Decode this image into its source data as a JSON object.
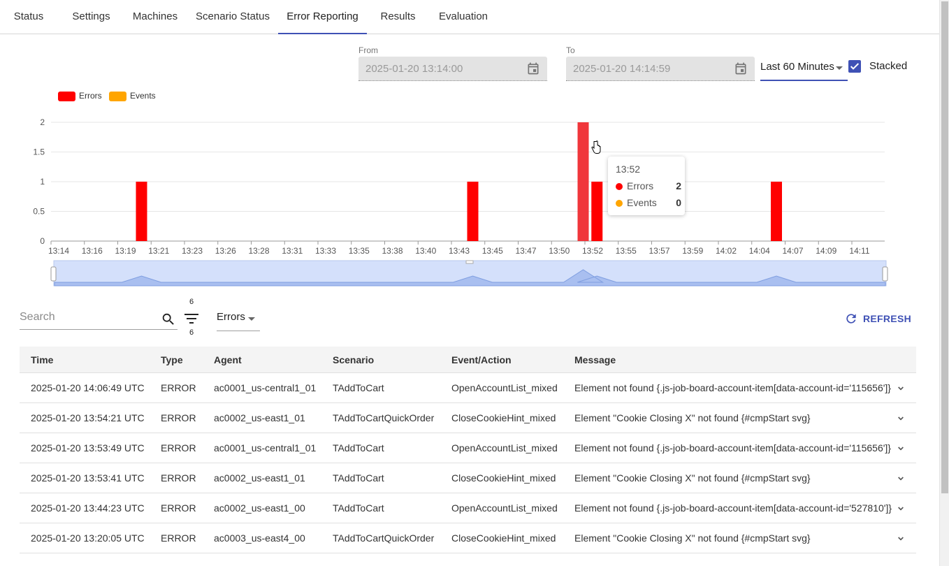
{
  "tabs": [
    {
      "label": "Status"
    },
    {
      "label": "Settings"
    },
    {
      "label": "Machines"
    },
    {
      "label": "Scenario Status"
    },
    {
      "label": "Error Reporting"
    },
    {
      "label": "Results"
    },
    {
      "label": "Evaluation"
    }
  ],
  "active_tab": "Error Reporting",
  "accent_color": "#3f51b5",
  "date_range": {
    "from_label": "From",
    "from_value": "2025-01-20 13:14:00",
    "to_label": "To",
    "to_value": "2025-01-20 14:14:59",
    "range_option": "Last 60 Minutes",
    "stacked_label": "Stacked",
    "stacked_checked": true
  },
  "chart_data": {
    "type": "bar",
    "stacked": true,
    "legend": [
      {
        "name": "Errors",
        "color": "#ff0000"
      },
      {
        "name": "Events",
        "color": "#ffa500"
      }
    ],
    "y_ticks": [
      "0",
      "0.5",
      "1",
      "1.5",
      "2"
    ],
    "ylim": [
      0,
      2
    ],
    "x_ticks": [
      "13:14",
      "13:16",
      "13:19",
      "13:21",
      "13:23",
      "13:26",
      "13:28",
      "13:31",
      "13:33",
      "13:35",
      "13:38",
      "13:40",
      "13:43",
      "13:45",
      "13:47",
      "13:50",
      "13:52",
      "13:55",
      "13:57",
      "13:59",
      "14:02",
      "14:04",
      "14:07",
      "14:09",
      "14:11"
    ],
    "series": [
      {
        "name": "Errors",
        "x": [
          "13:20",
          "13:44",
          "13:52",
          "13:53",
          "14:06"
        ],
        "values": [
          1,
          1,
          2,
          1,
          1
        ]
      },
      {
        "name": "Events",
        "x": [
          "13:20",
          "13:44",
          "13:52",
          "13:53",
          "14:06"
        ],
        "values": [
          0,
          0,
          0,
          0,
          0
        ]
      }
    ],
    "highlighted": "13:52",
    "tooltip": {
      "title": "13:52",
      "rows": [
        {
          "name": "Errors",
          "value": "2",
          "color": "#ff0000"
        },
        {
          "name": "Events",
          "value": "0",
          "color": "#ffa500"
        }
      ]
    },
    "grid": true,
    "legend_position": "top-left"
  },
  "filters": {
    "search_placeholder": "Search",
    "filter_count_top": "6",
    "filter_count_bottom": "6",
    "type_value": "Errors",
    "refresh_label": "REFRESH"
  },
  "table": {
    "headers": [
      "Time",
      "Type",
      "Agent",
      "Scenario",
      "Event/Action",
      "Message"
    ],
    "rows": [
      {
        "time": "2025-01-20  14:06:49 UTC",
        "type": "ERROR",
        "agent": "ac0001_us-central1_01",
        "scenario": "TAddToCart",
        "event": "OpenAccountList_mixed",
        "message": "Element not found {.js-job-board-account-item[data-account-id='115656']}"
      },
      {
        "time": "2025-01-20  13:54:21 UTC",
        "type": "ERROR",
        "agent": "ac0002_us-east1_01",
        "scenario": "TAddToCartQuickOrder",
        "event": "CloseCookieHint_mixed",
        "message": "Element \"Cookie Closing X\" not found {#cmpStart svg}"
      },
      {
        "time": "2025-01-20  13:53:49 UTC",
        "type": "ERROR",
        "agent": "ac0001_us-central1_01",
        "scenario": "TAddToCart",
        "event": "OpenAccountList_mixed",
        "message": "Element not found {.js-job-board-account-item[data-account-id='115656']}"
      },
      {
        "time": "2025-01-20  13:53:41 UTC",
        "type": "ERROR",
        "agent": "ac0002_us-east1_01",
        "scenario": "TAddToCart",
        "event": "CloseCookieHint_mixed",
        "message": "Element \"Cookie Closing X\" not found {#cmpStart svg}"
      },
      {
        "time": "2025-01-20  13:44:23 UTC",
        "type": "ERROR",
        "agent": "ac0002_us-east1_00",
        "scenario": "TAddToCart",
        "event": "OpenAccountList_mixed",
        "message": "Element not found {.js-job-board-account-item[data-account-id='527810']}"
      },
      {
        "time": "2025-01-20  13:20:05 UTC",
        "type": "ERROR",
        "agent": "ac0003_us-east4_00",
        "scenario": "TAddToCartQuickOrder",
        "event": "CloseCookieHint_mixed",
        "message": "Element \"Cookie Closing X\" not found {#cmpStart svg}"
      }
    ]
  }
}
